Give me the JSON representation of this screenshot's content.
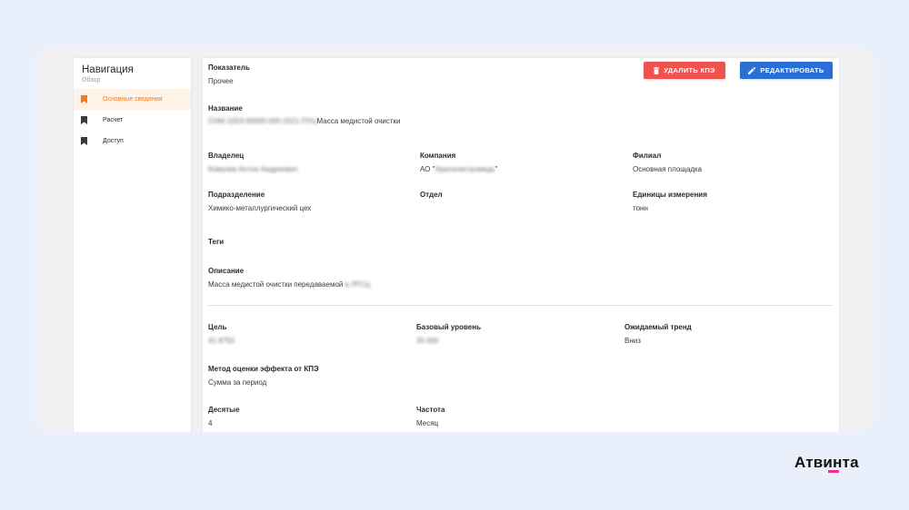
{
  "colors": {
    "accent_orange": "#f07c20",
    "delete_red": "#ef5350",
    "edit_blue": "#2b6fd4",
    "logo_pink": "#e8329a"
  },
  "sidebar": {
    "title": "Навигация",
    "subtitle": "Обзор",
    "items": [
      {
        "label": "Основные сведения",
        "icon": "bookmark-icon",
        "active": true
      },
      {
        "label": "Расчет",
        "icon": "bookmark-icon",
        "active": false
      },
      {
        "label": "Доступ",
        "icon": "bookmark-icon",
        "active": false
      }
    ]
  },
  "actions": {
    "delete_label": "УДАЛИТЬ КПЭ",
    "delete_icon": "trash-icon",
    "edit_label": "РЕДАКТИРОВАТЬ",
    "edit_icon": "pencil-icon"
  },
  "fields": {
    "indicator": {
      "label": "Показатель",
      "value": "Прочее"
    },
    "name": {
      "label": "Название",
      "code": "СНМ-1003-00000-000-2021-ПУЦ",
      "value": "Масса медистой очистки"
    },
    "owner": {
      "label": "Владелец",
      "value": "Ковалев Антон Андреевич"
    },
    "company": {
      "label": "Компания",
      "prefix": "АО \"",
      "hidden": "Уралэлектромедь",
      "suffix": "\""
    },
    "branch": {
      "label": "Филиал",
      "value": "Основная площадка"
    },
    "division": {
      "label": "Подразделение",
      "value": "Химико-металлургический цех"
    },
    "department": {
      "label": "Отдел",
      "value": ""
    },
    "units": {
      "label": "Единицы измерения",
      "value": "тонн"
    },
    "tags": {
      "label": "Теги",
      "value": ""
    },
    "description": {
      "label": "Описание",
      "value": "Масса медистой очистки передаваемой",
      "hidden": "в ЛГСЦ"
    },
    "target": {
      "label": "Цель",
      "value": "41 8750"
    },
    "baseline": {
      "label": "Базовый уровень",
      "value": "35 000"
    },
    "trend": {
      "label": "Ожидаемый тренд",
      "value": "Вниз"
    },
    "method": {
      "label": "Метод оценки эффекта от КПЭ",
      "value": "Сумма за период"
    },
    "decimals": {
      "label": "Десятые",
      "value": "4"
    },
    "frequency": {
      "label": "Частота",
      "value": "Месяц"
    }
  },
  "logo": {
    "text": "Атвинта"
  }
}
